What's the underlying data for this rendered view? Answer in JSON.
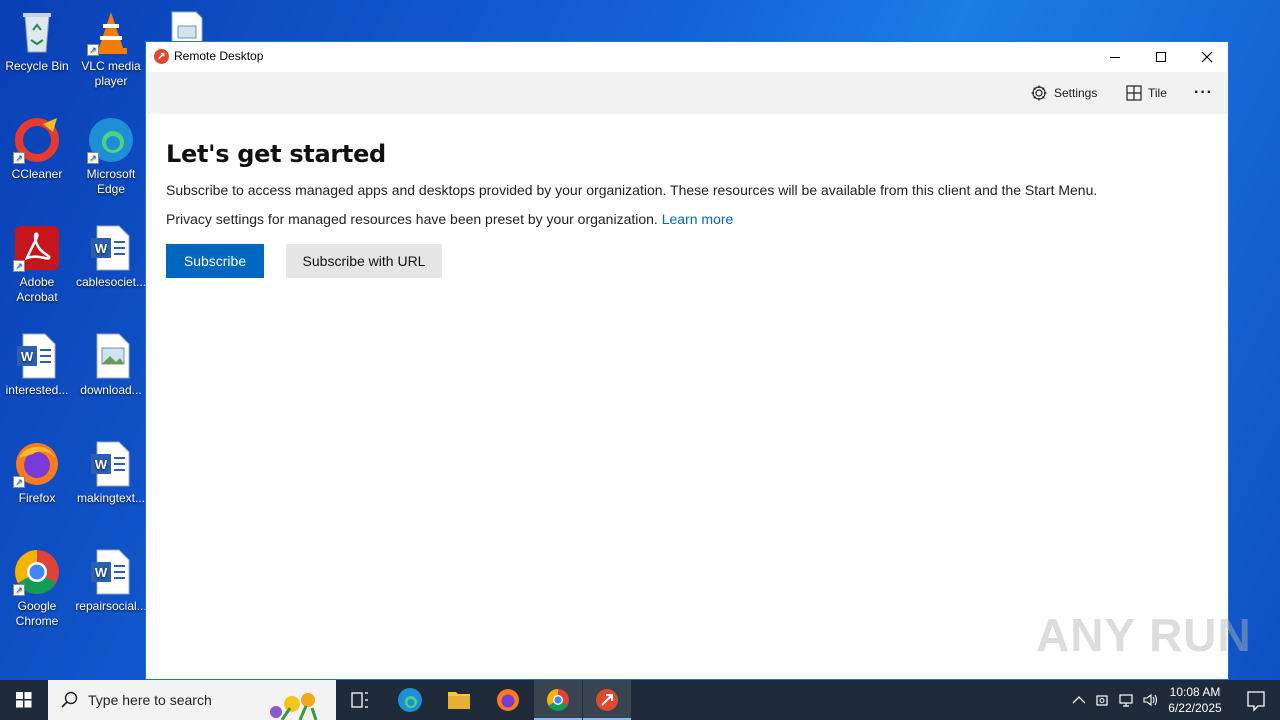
{
  "desktop": {
    "icons": [
      {
        "label": "Recycle Bin"
      },
      {
        "label": "VLC media player"
      },
      {
        "label": "CCleaner"
      },
      {
        "label": "Microsoft Edge"
      },
      {
        "label": "Adobe Acrobat"
      },
      {
        "label": "cablesociet..."
      },
      {
        "label": "interested..."
      },
      {
        "label": "download..."
      },
      {
        "label": "Firefox"
      },
      {
        "label": "makingtext..."
      },
      {
        "label": "Google Chrome"
      },
      {
        "label": "repairsocial..."
      }
    ]
  },
  "window": {
    "title": "Remote Desktop",
    "toolbar": {
      "settings_label": "Settings",
      "tile_label": "Tile",
      "more_label": "···"
    },
    "content": {
      "heading": "Let's get started",
      "paragraph1": "Subscribe to access managed apps and desktops provided by your organization. These resources will be available from this client and the Start Menu.",
      "paragraph2": "Privacy settings for managed resources have been preset by your organization.",
      "learn_more": "Learn more",
      "subscribe_label": "Subscribe",
      "subscribe_url_label": "Subscribe with URL"
    }
  },
  "taskbar": {
    "search_placeholder": "Type here to search",
    "time": "10:08 AM",
    "date": "6/22/2025"
  },
  "watermark": "ANY RUN",
  "colors": {
    "accent": "#0067c0",
    "taskbar": "#1f2b3a"
  }
}
